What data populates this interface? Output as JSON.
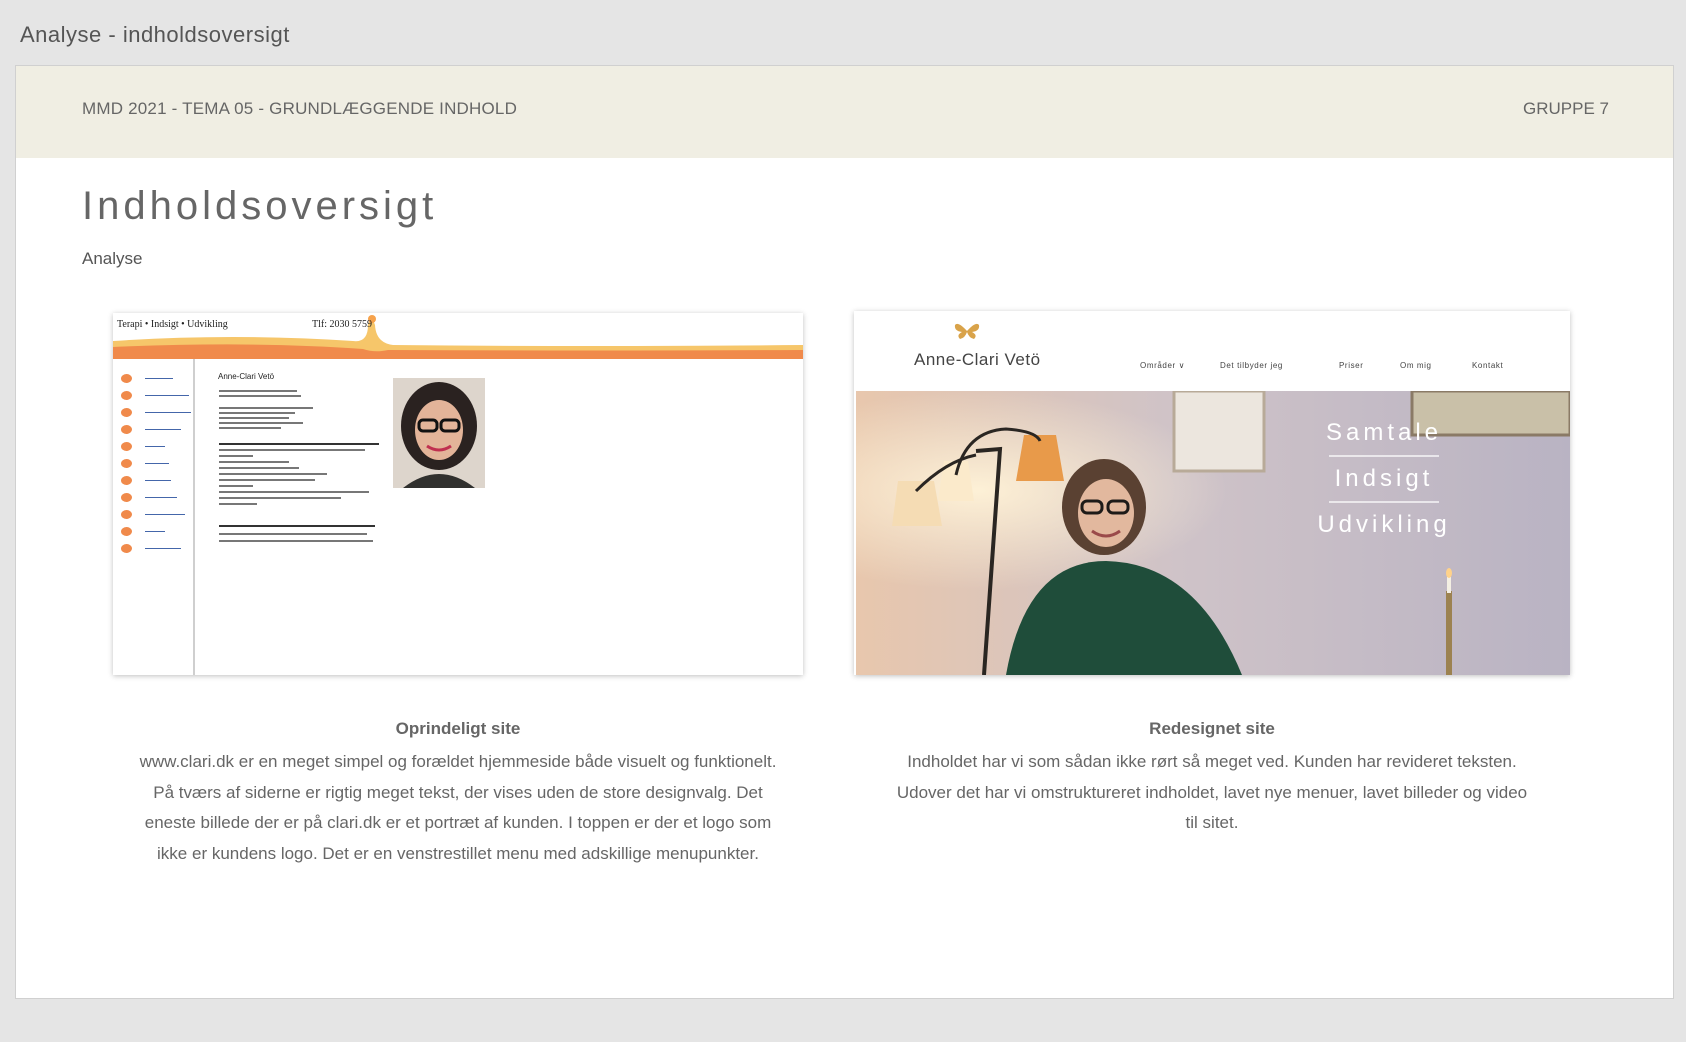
{
  "window": {
    "title": "Analyse - indholdsoversigt"
  },
  "header": {
    "course": "MMD 2021 - TEMA 05 - GRUNDLÆGGENDE INDHOLD",
    "group": "GRUPPE 7"
  },
  "page": {
    "title": "Indholdsoversigt",
    "subtitle": "Analyse"
  },
  "original_site": {
    "tagline": "Terapi • Indsigt • Udvikling",
    "phone": "Tlf: 2030 5759",
    "name": "Anne-Clari Vetö",
    "accent_color": "#f08a4b",
    "caption_title": "Oprindeligt site",
    "caption_lines": [
      "www.clari.dk er en meget simpel og forældet hjemmeside både visuelt og funktionelt.",
      "På tværs af siderne er rigtig meget tekst, der vises uden de store designvalg. Det",
      "eneste billede der er på clari.dk er et portræt af kunden. I toppen er der et logo som",
      "ikke er kundens logo. Det er en venstrestillet menu med adskillige menupunkter."
    ]
  },
  "redesigned_site": {
    "logo": "Anne-Clari Vetö",
    "nav": [
      "Områder ∨",
      "Det tilbyder jeg",
      "Priser",
      "Om mig",
      "Kontakt"
    ],
    "hero_words": [
      "Samtale",
      "Indsigt",
      "Udvikling"
    ],
    "caption_title": "Redesignet site",
    "caption_lines": [
      "Indholdet har vi som sådan ikke rørt så meget ved. Kunden har revideret teksten.",
      "Udover det har vi omstruktureret indholdet, lavet nye menuer, lavet billeder og video",
      "til sitet."
    ]
  },
  "colors": {
    "header_band": "#f0eee3",
    "background": "#e5e5e5",
    "text": "#666666"
  }
}
